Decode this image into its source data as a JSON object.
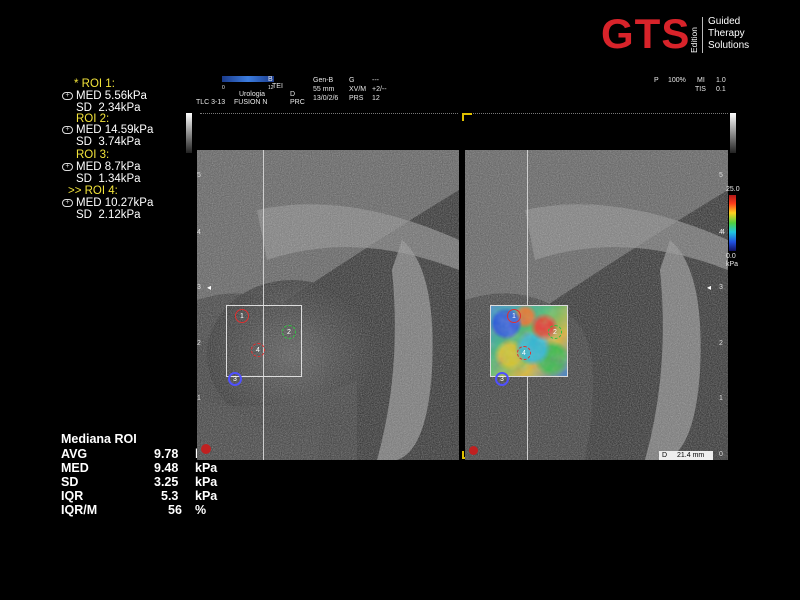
{
  "logo": {
    "brand": "GTS",
    "edition": "Edition",
    "tagline": [
      "Guided",
      "Therapy",
      "Solutions"
    ],
    "brand_color": "#d8232a"
  },
  "header": {
    "probe": "TLC 3-13",
    "scale_left": "0",
    "scale_b": "B",
    "scale_right": "12",
    "preset_1": "Urologia",
    "preset_2": "FUSION N",
    "col_tei": "TEI",
    "col_d": "D",
    "col_prc": "PRC",
    "col_gen": "Gen-B",
    "col_depth": "55 mm",
    "col_prc_val": "13/0/2/6",
    "col_g": "G",
    "col_xvm": "XV/M",
    "col_prs": "PRS",
    "col_g_val": "---",
    "col_xvm_val": "+2/--",
    "col_prs_val": "12",
    "power_label": "P",
    "power_val": "100%",
    "mi_label": "MI",
    "mi_val": "1.0",
    "tis_label": "TIS",
    "tis_val": "0.1"
  },
  "rois": [
    {
      "title": "* ROI 1:",
      "med": "MED 5.56kPa",
      "sd": "SD  2.34kPa"
    },
    {
      "title": "ROI 2:",
      "med": "MED 14.59kPa",
      "sd": "SD  3.74kPa"
    },
    {
      "title": "ROI 3:",
      "med": "MED 8.7kPa",
      "sd": "SD  1.34kPa"
    },
    {
      "title": ">> ROI 4:",
      "med": "MED 10.27kPa",
      "sd": "SD  2.12kPa"
    }
  ],
  "summary": {
    "title": "Mediana ROI",
    "rows": [
      {
        "label": "AVG",
        "value": "9.78",
        "unit": "kPa"
      },
      {
        "label": "MED",
        "value": "9.48",
        "unit": "kPa"
      },
      {
        "label": "SD",
        "value": "3.25",
        "unit": "kPa"
      },
      {
        "label": "IQR",
        "value": "5.3",
        "unit": "kPa"
      },
      {
        "label": "IQR/M",
        "value": "56",
        "unit": "%"
      }
    ]
  },
  "colorbar": {
    "max": "25.0",
    "mid": "4",
    "min": "0.0",
    "unit": "kPa"
  },
  "depth_ruler_left": [
    "5",
    "4",
    "3",
    "2",
    "1"
  ],
  "depth_ruler_right": [
    "5",
    "4",
    "3",
    "2",
    "1",
    "0"
  ],
  "roi_markers": [
    "1",
    "2",
    "3",
    "4"
  ],
  "measurement": {
    "label": "D",
    "value": "21.4 mm"
  }
}
